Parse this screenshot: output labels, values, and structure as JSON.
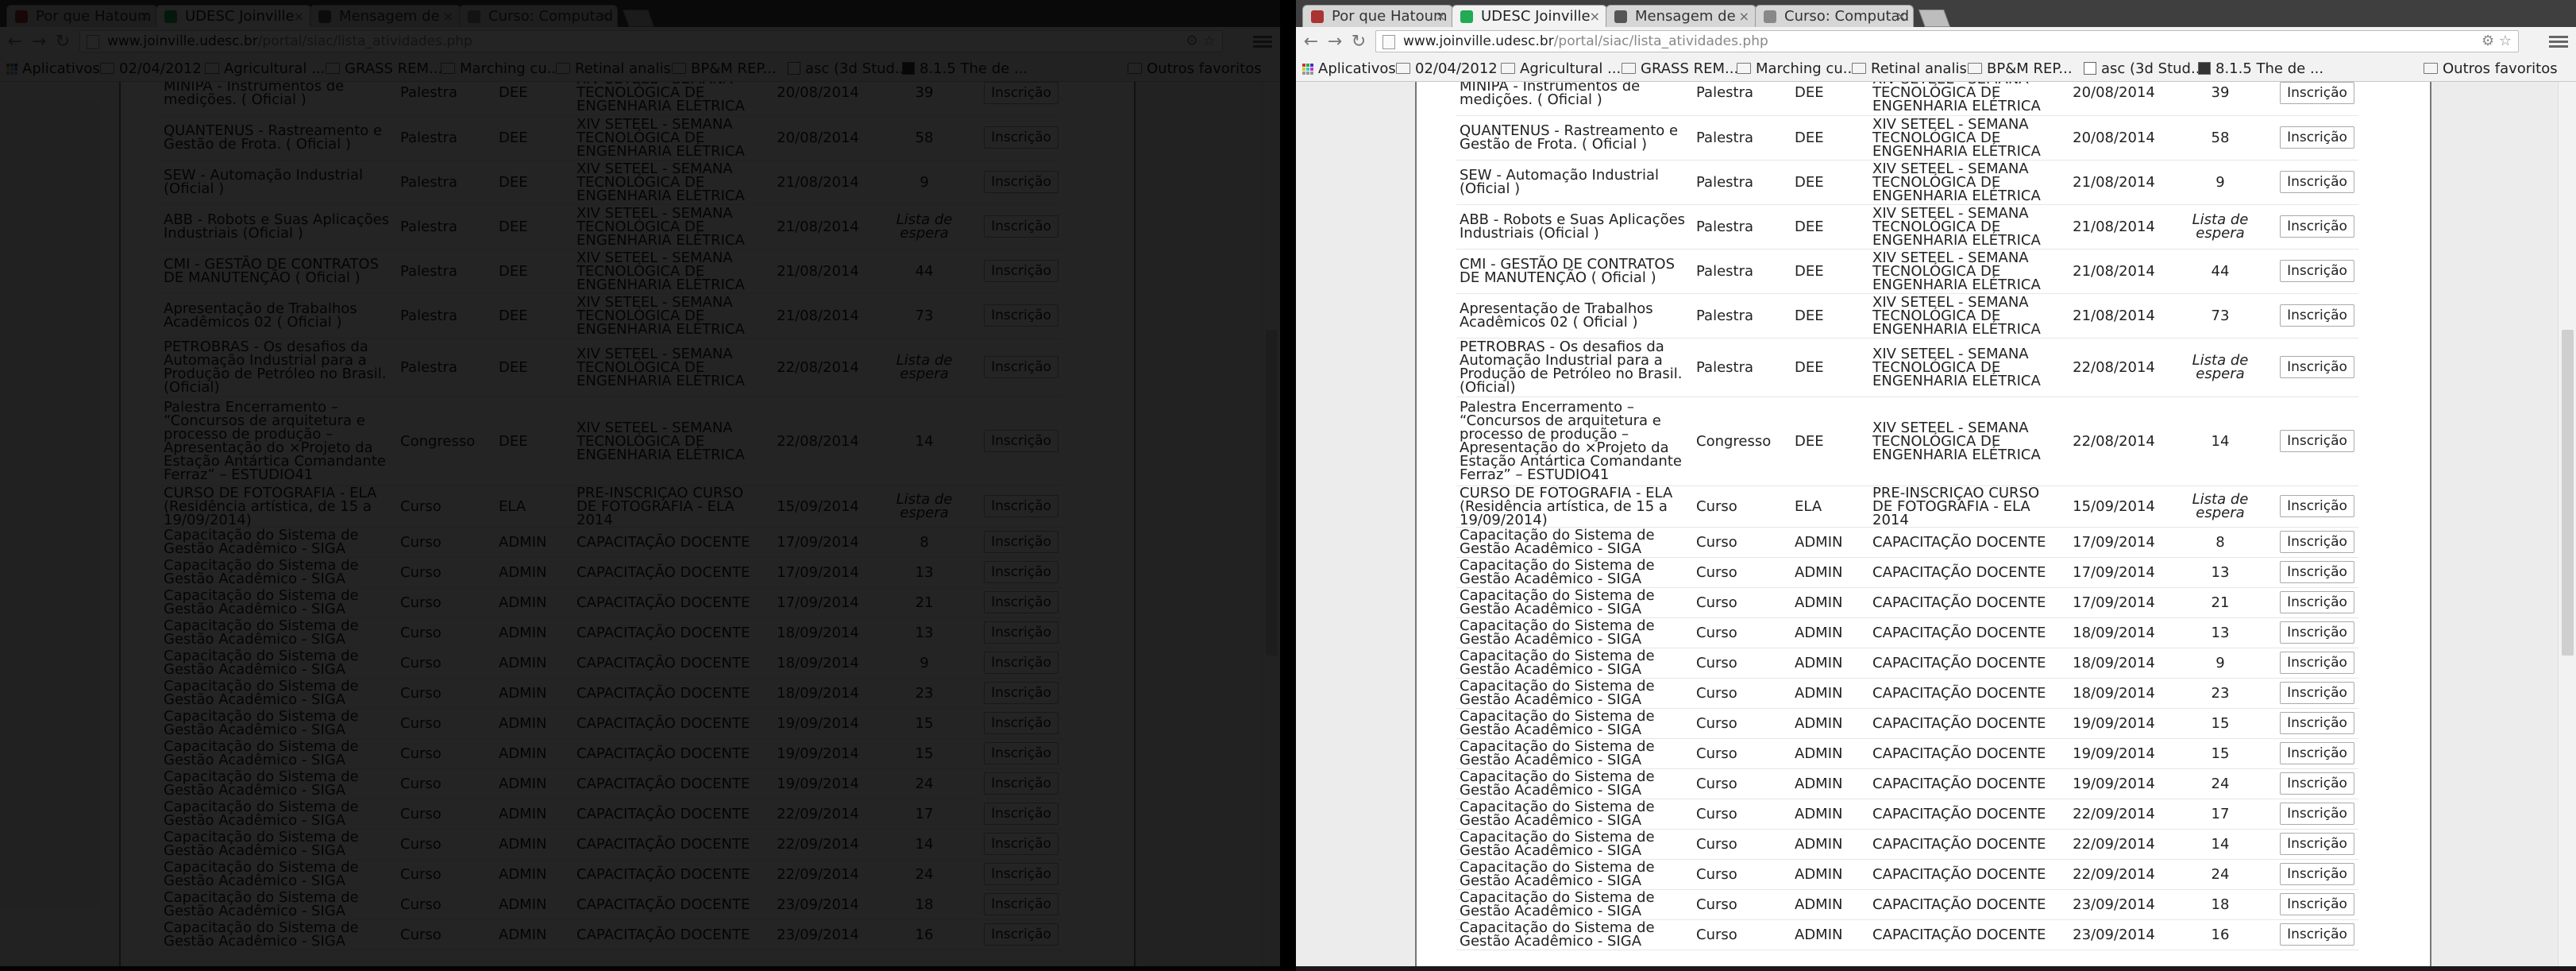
{
  "browser": {
    "tabs": [
      {
        "title": "Por que Hatoum"
      },
      {
        "title": "UDESC Joinville"
      },
      {
        "title": "Mensagem de"
      },
      {
        "title": "Curso: Computad"
      }
    ],
    "url_host": "www.joinville.udesc.br",
    "url_path": "/portal/siac/lista_atividades.php",
    "bookmarks": [
      "Aplicativos",
      "02/04/2012",
      "Agricultural ...",
      "GRASS REM...",
      "Marching cu...",
      "Retinal analis...",
      "BP&M REP...",
      "asc (3d Stud...",
      "8.1.5 The de ...",
      "Outros favoritos"
    ],
    "colors": {
      "tab_active": "#f2f2f2",
      "page_bg": "#ececec",
      "content_bg": "#ffffff"
    }
  },
  "activities": {
    "button_label": "Inscrição",
    "rows": [
      {
        "name": "MINIPA - Instrumentos de medições. ( Oficial )",
        "tipo": "Palestra",
        "dept": "DEE",
        "evento": "XIV SETEEL - SEMANA TECNOLÓGICA DE ENGENHARIA ELÉTRICA",
        "data": "20/08/2014",
        "vagas": "39"
      },
      {
        "name": "QUANTENUS - Rastreamento e Gestão de Frota. ( Oficial )",
        "tipo": "Palestra",
        "dept": "DEE",
        "evento": "XIV SETEEL - SEMANA TECNOLÓGICA DE ENGENHARIA ELÉTRICA",
        "data": "20/08/2014",
        "vagas": "58"
      },
      {
        "name": "SEW - Automação Industrial (Oficial )",
        "tipo": "Palestra",
        "dept": "DEE",
        "evento": "XIV SETEEL - SEMANA TECNOLÓGICA DE ENGENHARIA ELÉTRICA",
        "data": "21/08/2014",
        "vagas": "9"
      },
      {
        "name": "ABB - Robots e Suas Aplicações Industriais (Oficial )",
        "tipo": "Palestra",
        "dept": "DEE",
        "evento": "XIV SETEEL - SEMANA TECNOLÓGICA DE ENGENHARIA ELÉTRICA",
        "data": "21/08/2014",
        "vagas": "Lista de espera"
      },
      {
        "name": "CMI - GESTÃO DE CONTRATOS DE MANUTENÇÃO ( Oficial )",
        "tipo": "Palestra",
        "dept": "DEE",
        "evento": "XIV SETEEL - SEMANA TECNOLÓGICA DE ENGENHARIA ELÉTRICA",
        "data": "21/08/2014",
        "vagas": "44"
      },
      {
        "name": "Apresentação de Trabalhos Acadêmicos 02 ( Oficial )",
        "tipo": "Palestra",
        "dept": "DEE",
        "evento": "XIV SETEEL - SEMANA TECNOLÓGICA DE ENGENHARIA ELÉTRICA",
        "data": "21/08/2014",
        "vagas": "73"
      },
      {
        "name": "PETROBRAS - Os desafios da Automação Industrial para a Produção de Petróleo no Brasil. (Oficial)",
        "tipo": "Palestra",
        "dept": "DEE",
        "evento": "XIV SETEEL - SEMANA TECNOLÓGICA DE ENGENHARIA ELÉTRICA",
        "data": "22/08/2014",
        "vagas": "Lista de espera"
      },
      {
        "name": "Palestra Encerramento – “Concursos de arquitetura e processo de produção – Apresentação do ×Projeto da Estação Antártica Comandante Ferraz” – ESTUDIO41",
        "tipo": "Congresso",
        "dept": "DEE",
        "evento": "XIV SETEEL - SEMANA TECNOLÓGICA DE ENGENHARIA ELÉTRICA",
        "data": "22/08/2014",
        "vagas": "14"
      },
      {
        "name": "CURSO DE FOTOGRAFIA - ELA (Residência artística, de 15 a 19/09/2014)",
        "tipo": "Curso",
        "dept": "ELA",
        "evento": "PRÉ-INSCRIÇÃO CURSO DE FOTOGRAFIA - ELA 2014",
        "data": "15/09/2014",
        "vagas": "Lista de espera"
      },
      {
        "name": "Capacitação do Sistema de Gestão Acadêmico - SIGA",
        "tipo": "Curso",
        "dept": "ADMIN",
        "evento": "CAPACITAÇÃO DOCENTE",
        "data": "17/09/2014",
        "vagas": "8"
      },
      {
        "name": "Capacitação do Sistema de Gestão Acadêmico - SIGA",
        "tipo": "Curso",
        "dept": "ADMIN",
        "evento": "CAPACITAÇÃO DOCENTE",
        "data": "17/09/2014",
        "vagas": "13"
      },
      {
        "name": "Capacitação do Sistema de Gestão Acadêmico - SIGA",
        "tipo": "Curso",
        "dept": "ADMIN",
        "evento": "CAPACITAÇÃO DOCENTE",
        "data": "17/09/2014",
        "vagas": "21"
      },
      {
        "name": "Capacitação do Sistema de Gestão Acadêmico - SIGA",
        "tipo": "Curso",
        "dept": "ADMIN",
        "evento": "CAPACITAÇÃO DOCENTE",
        "data": "18/09/2014",
        "vagas": "13"
      },
      {
        "name": "Capacitação do Sistema de Gestão Acadêmico - SIGA",
        "tipo": "Curso",
        "dept": "ADMIN",
        "evento": "CAPACITAÇÃO DOCENTE",
        "data": "18/09/2014",
        "vagas": "9"
      },
      {
        "name": "Capacitação do Sistema de Gestão Acadêmico - SIGA",
        "tipo": "Curso",
        "dept": "ADMIN",
        "evento": "CAPACITAÇÃO DOCENTE",
        "data": "18/09/2014",
        "vagas": "23"
      },
      {
        "name": "Capacitação do Sistema de Gestão Acadêmico - SIGA",
        "tipo": "Curso",
        "dept": "ADMIN",
        "evento": "CAPACITAÇÃO DOCENTE",
        "data": "19/09/2014",
        "vagas": "15"
      },
      {
        "name": "Capacitação do Sistema de Gestão Acadêmico - SIGA",
        "tipo": "Curso",
        "dept": "ADMIN",
        "evento": "CAPACITAÇÃO DOCENTE",
        "data": "19/09/2014",
        "vagas": "15"
      },
      {
        "name": "Capacitação do Sistema de Gestão Acadêmico - SIGA",
        "tipo": "Curso",
        "dept": "ADMIN",
        "evento": "CAPACITAÇÃO DOCENTE",
        "data": "19/09/2014",
        "vagas": "24"
      },
      {
        "name": "Capacitação do Sistema de Gestão Acadêmico - SIGA",
        "tipo": "Curso",
        "dept": "ADMIN",
        "evento": "CAPACITAÇÃO DOCENTE",
        "data": "22/09/2014",
        "vagas": "17"
      },
      {
        "name": "Capacitação do Sistema de Gestão Acadêmico - SIGA",
        "tipo": "Curso",
        "dept": "ADMIN",
        "evento": "CAPACITAÇÃO DOCENTE",
        "data": "22/09/2014",
        "vagas": "14"
      },
      {
        "name": "Capacitação do Sistema de Gestão Acadêmico - SIGA",
        "tipo": "Curso",
        "dept": "ADMIN",
        "evento": "CAPACITAÇÃO DOCENTE",
        "data": "22/09/2014",
        "vagas": "24"
      },
      {
        "name": "Capacitação do Sistema de Gestão Acadêmico - SIGA",
        "tipo": "Curso",
        "dept": "ADMIN",
        "evento": "CAPACITAÇÃO DOCENTE",
        "data": "23/09/2014",
        "vagas": "18"
      },
      {
        "name": "Capacitação do Sistema de Gestão Acadêmico - SIGA",
        "tipo": "Curso",
        "dept": "ADMIN",
        "evento": "CAPACITAÇÃO DOCENTE",
        "data": "23/09/2014",
        "vagas": "16"
      }
    ]
  }
}
